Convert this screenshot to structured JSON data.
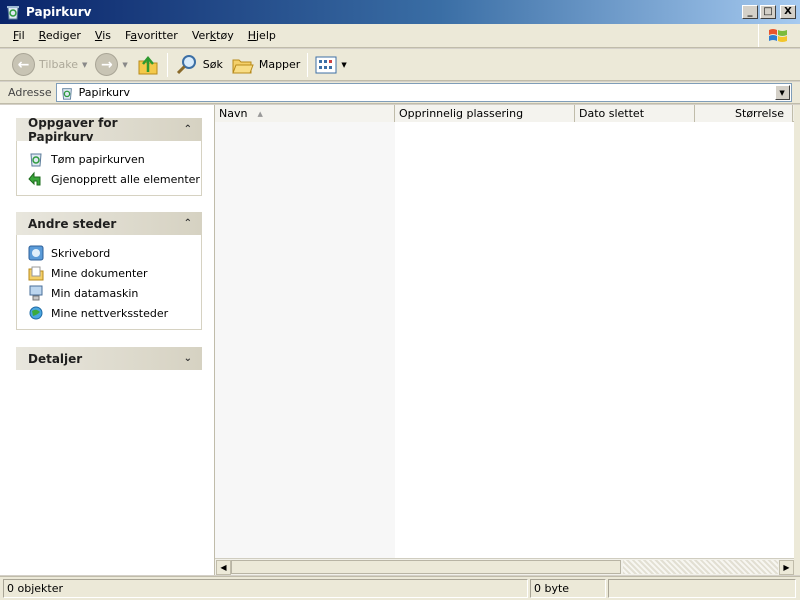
{
  "window": {
    "title": "Papirkurv",
    "controls": {
      "minimize": "_",
      "maximize": "□",
      "close": "X"
    }
  },
  "menu": [
    {
      "label": "Fil",
      "key": "F"
    },
    {
      "label": "Rediger",
      "key": "R"
    },
    {
      "label": "Vis",
      "key": "V"
    },
    {
      "label": "Favoritter",
      "key": "a"
    },
    {
      "label": "Verktøy",
      "key": "k"
    },
    {
      "label": "Hjelp",
      "key": "H"
    }
  ],
  "toolbar": {
    "back_label": "Tilbake",
    "search_label": "Søk",
    "folders_label": "Mapper"
  },
  "address": {
    "label": "Adresse",
    "value": "Papirkurv"
  },
  "taskpane": {
    "tasks": {
      "title": "Oppgaver for Papirkurv",
      "items": [
        "Tøm papirkurven",
        "Gjenopprett alle elementer"
      ]
    },
    "places": {
      "title": "Andre steder",
      "items": [
        "Skrivebord",
        "Mine dokumenter",
        "Min datamaskin",
        "Mine nettverkssteder"
      ]
    },
    "details": {
      "title": "Detaljer"
    }
  },
  "listview": {
    "columns": [
      "Navn",
      "Opprinnelig plassering",
      "Dato slettet",
      "Størrelse"
    ]
  },
  "status": {
    "count": "0 objekter",
    "size": "0 byte"
  },
  "colors": {
    "titlebar": "#0a246a",
    "chrome": "#ece9d8",
    "pane": "#ffffff"
  }
}
